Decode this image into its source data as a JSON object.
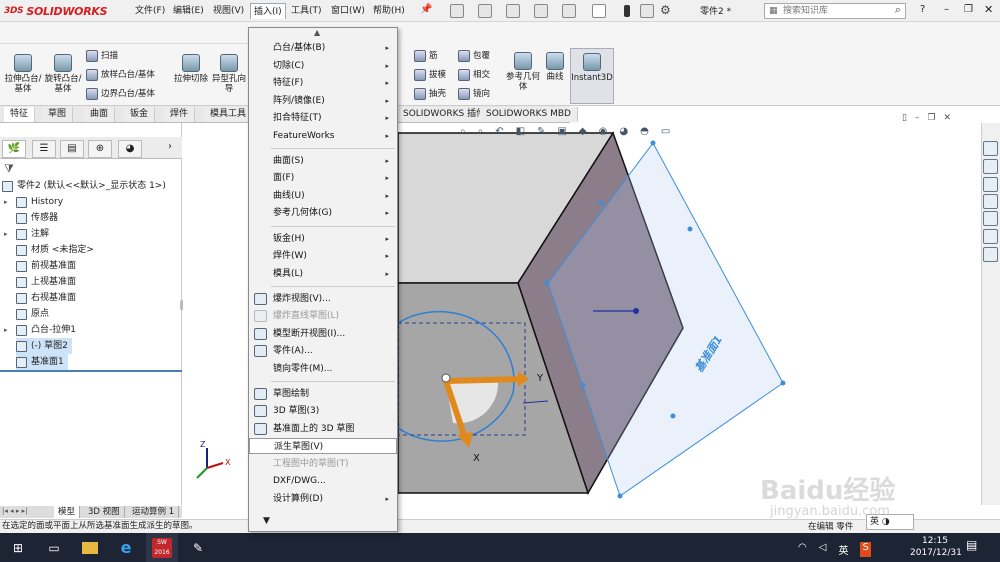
{
  "app": {
    "logo_prefix": "3DS",
    "logo_text": "SOLIDWORKS",
    "part_name": "零件2 *"
  },
  "menubar": {
    "items": [
      "文件(F)",
      "编辑(E)",
      "视图(V)",
      "插入(I)",
      "工具(T)",
      "窗口(W)",
      "帮助(H)"
    ]
  },
  "search": {
    "placeholder": "搜索知识库"
  },
  "ribbon": {
    "big_buttons": [
      "拉伸凸台/基体",
      "旋转凸台/基体",
      "拉伸切除",
      "异型孔向导"
    ],
    "small_buttons": [
      "扫描",
      "放样凸台/基体",
      "边界凸台/基体"
    ],
    "right_buttons": [
      "筋",
      "包覆",
      "拔模",
      "相交",
      "抽壳",
      "镜向"
    ],
    "ref_geom": "参考几何体",
    "curves": "曲线",
    "instant3d": "Instant3D"
  },
  "tabs": [
    "特征",
    "草图",
    "曲面",
    "钣金",
    "焊件",
    "模具工具",
    "SOLIDWORKS 插件",
    "SOLIDWORKS MBD"
  ],
  "tree": {
    "root": "零件2 (默认<<默认>_显示状态 1>)",
    "items": [
      "History",
      "传感器",
      "注解",
      "材质 <未指定>",
      "前视基准面",
      "上视基准面",
      "右视基准面",
      "原点",
      "凸台-拉伸1",
      "(-) 草图2",
      "基准面1"
    ]
  },
  "dropdown": {
    "items": [
      "凸台/基体(B)",
      "切除(C)",
      "特征(F)",
      "阵列/镜像(E)",
      "扣合特征(T)",
      "FeatureWorks",
      "曲面(S)",
      "面(F)",
      "曲线(U)",
      "参考几何体(G)",
      "钣金(H)",
      "焊件(W)",
      "模具(L)",
      "爆炸视图(V)...",
      "爆炸直线草图(L)",
      "模型断开视图(I)...",
      "零件(A)...",
      "镜向零件(M)...",
      "草图绘制",
      "3D 草图(3)",
      "基准面上的 3D 草图",
      "派生草图(V)",
      "工程图中的草图(T)",
      "DXF/DWG...",
      "设计算例(D)"
    ]
  },
  "viewport": {
    "plane_label": "基准面1",
    "axis_x": "X",
    "axis_y": "Y",
    "triad_x": "X",
    "triad_z": "Z"
  },
  "bottom_tabs": [
    "模型",
    "3D 视图",
    "运动算例 1"
  ],
  "status": {
    "text": "在选定的面或平面上从所选基准面生成派生的草图。",
    "right": "在编辑 零件"
  },
  "taskbar": {
    "ime": "英",
    "time": "12:15",
    "date": "2017/12/31",
    "sw_label": "SW 2016"
  },
  "watermark": {
    "text": "Baidu经验",
    "url": "jingyan.baidu.com"
  }
}
